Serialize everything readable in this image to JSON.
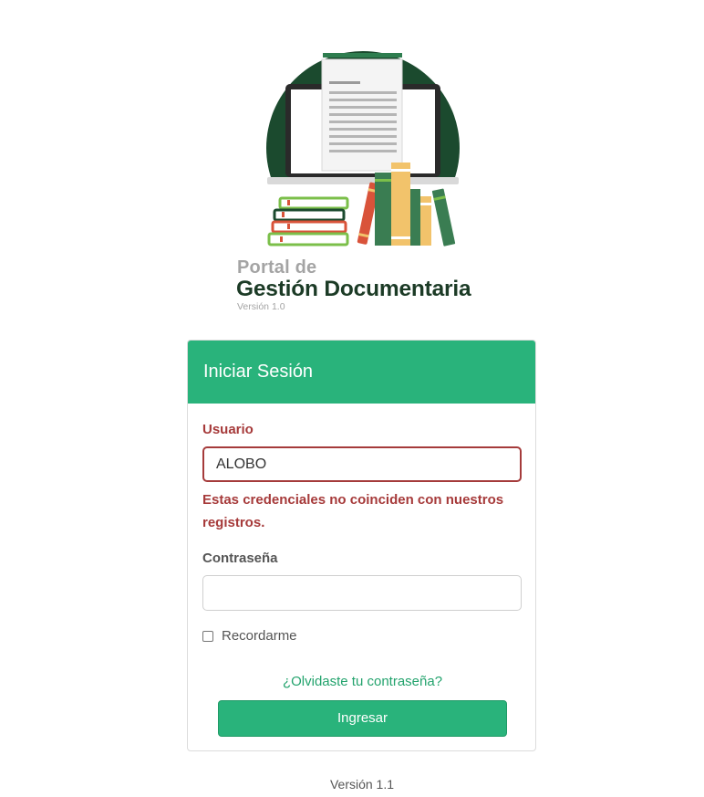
{
  "logo": {
    "line1": "Portal de",
    "line2": "Gestión Documentaria",
    "version": "Versión 1.0"
  },
  "card": {
    "title": "Iniciar Sesión",
    "username": {
      "label": "Usuario",
      "value": "ALOBO",
      "error": "Estas credenciales no coinciden con nuestros registros."
    },
    "password": {
      "label": "Contraseña",
      "value": ""
    },
    "remember_label": "Recordarme",
    "forgot_link": "¿Olvidaste tu contraseña?",
    "submit_label": "Ingresar"
  },
  "footer": {
    "version": "Versión 1.1"
  },
  "colors": {
    "accent": "#29b37b",
    "error": "#a63a3a",
    "logo_dark": "#1c3b26"
  }
}
